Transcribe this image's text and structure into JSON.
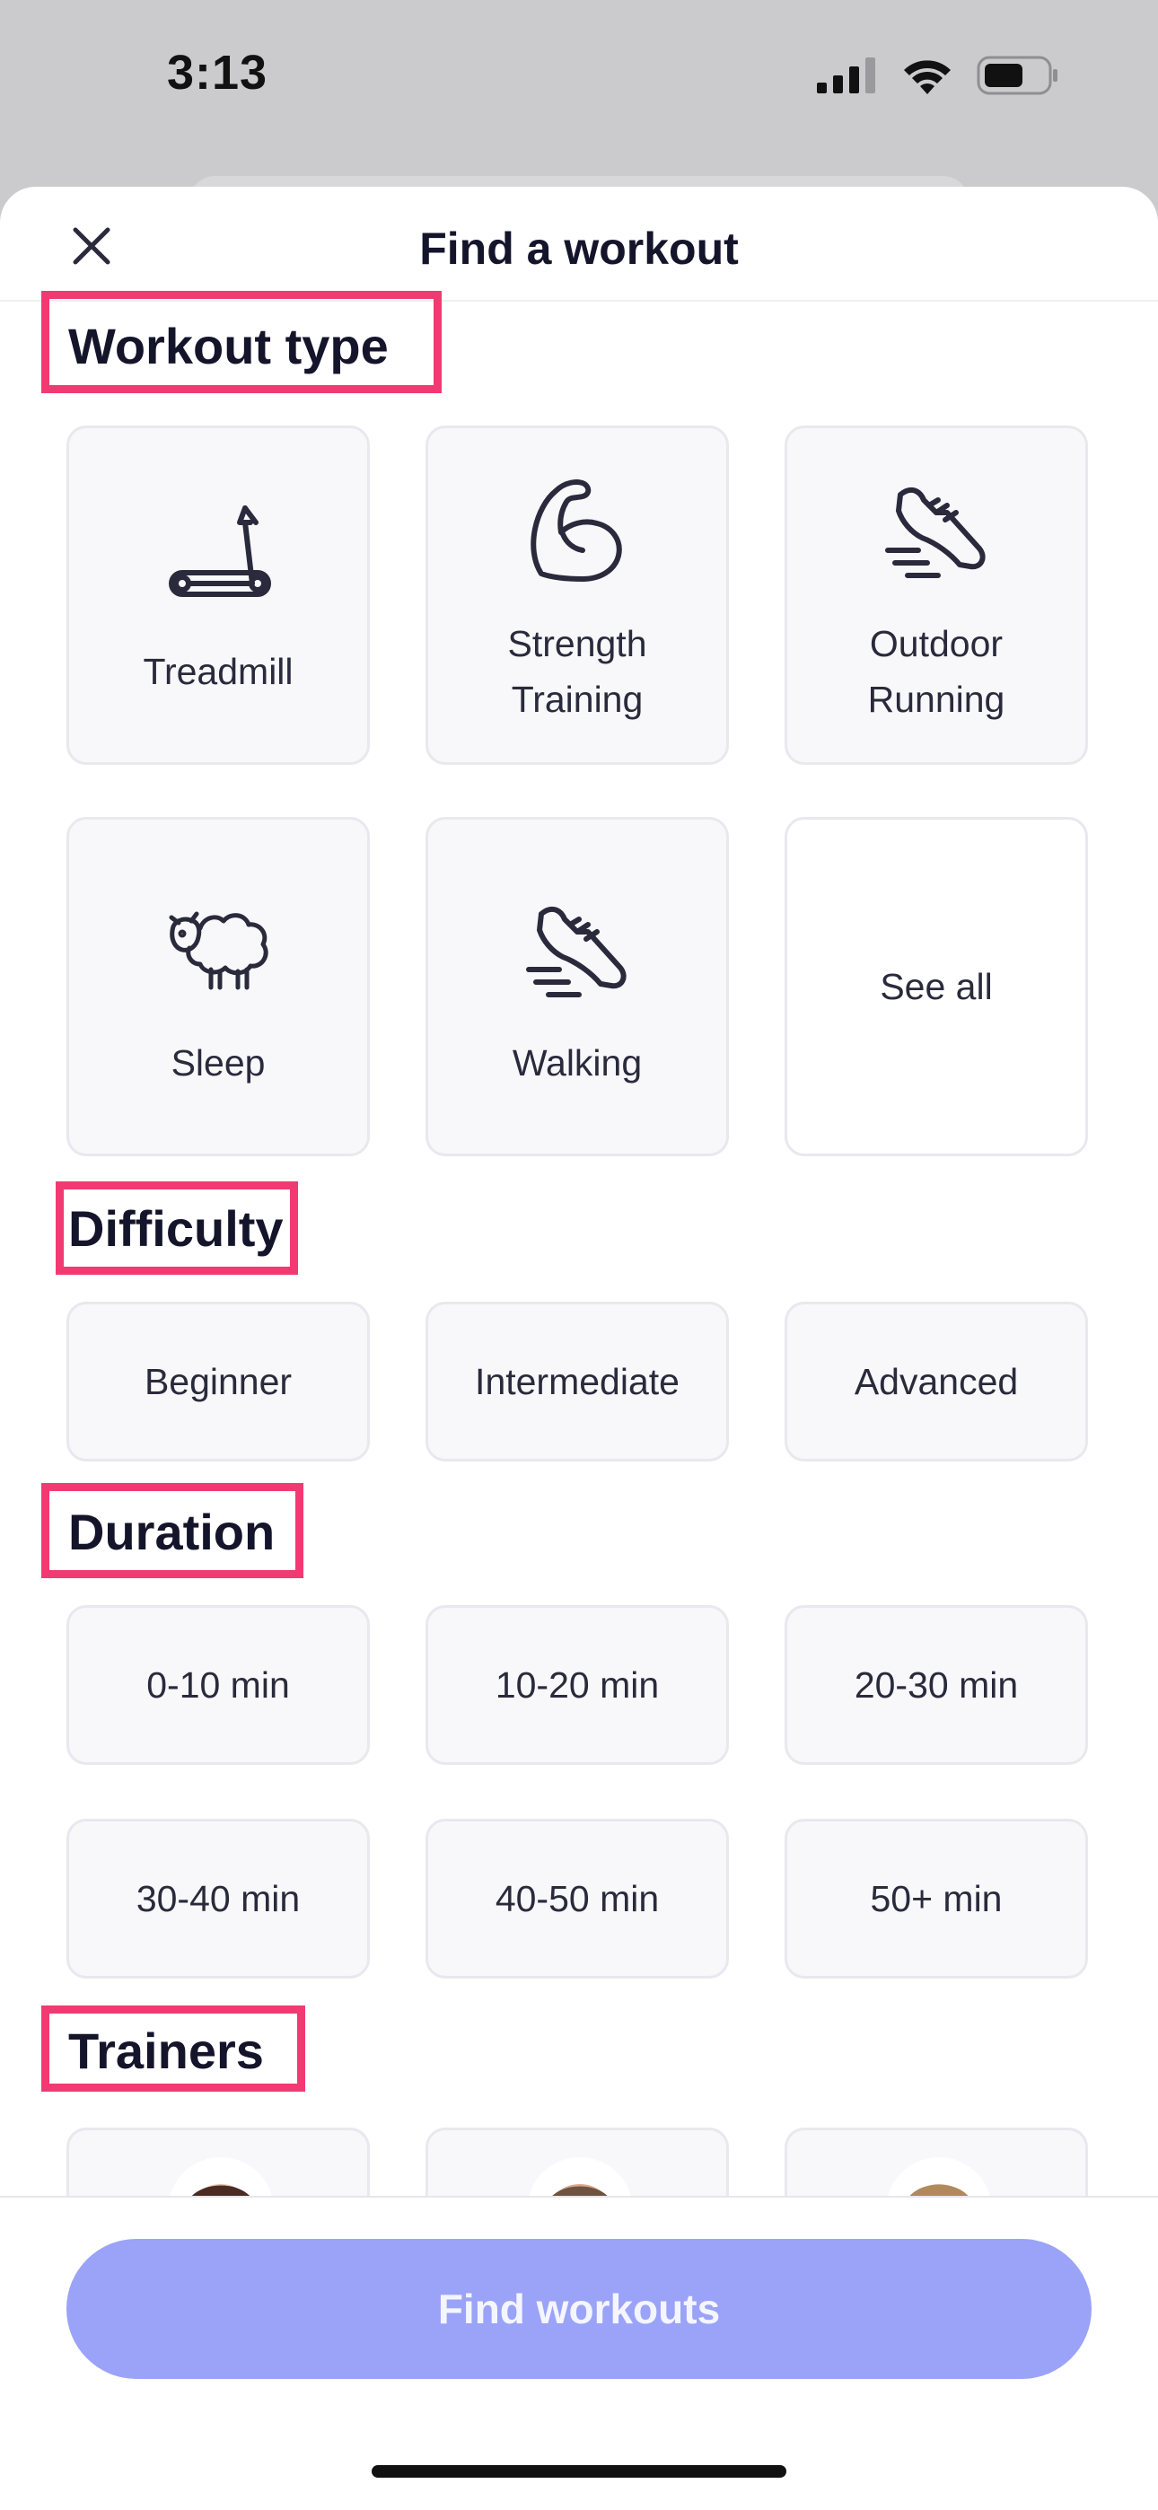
{
  "status_bar": {
    "time": "3:13",
    "icons": [
      "cellular-signal-icon",
      "wifi-icon",
      "battery-icon"
    ]
  },
  "sheet": {
    "title": "Find a workout",
    "close_icon": "close-icon"
  },
  "sections": {
    "workout_type": {
      "title": "Workout type",
      "items": [
        {
          "label": "Treadmill",
          "icon": "treadmill-icon"
        },
        {
          "label": "Strength\nTraining",
          "icon": "flexed-arm-icon"
        },
        {
          "label": "Outdoor\nRunning",
          "icon": "running-shoe-icon"
        },
        {
          "label": "Sleep",
          "icon": "sheep-icon"
        },
        {
          "label": "Walking",
          "icon": "walking-shoe-icon"
        },
        {
          "label": "See all",
          "icon": ""
        }
      ]
    },
    "difficulty": {
      "title": "Difficulty",
      "options": [
        "Beginner",
        "Intermediate",
        "Advanced"
      ]
    },
    "duration": {
      "title": "Duration",
      "options": [
        "0-10 min",
        "10-20 min",
        "20-30 min",
        "30-40 min",
        "40-50 min",
        "50+ min"
      ]
    },
    "trainers": {
      "title": "Trainers"
    }
  },
  "footer": {
    "button_label": "Find workouts"
  },
  "colors": {
    "highlight": "#f23a72",
    "button": "#9aa3f8",
    "tile_bg": "#f8f8fb",
    "title_text": "#14142b"
  }
}
